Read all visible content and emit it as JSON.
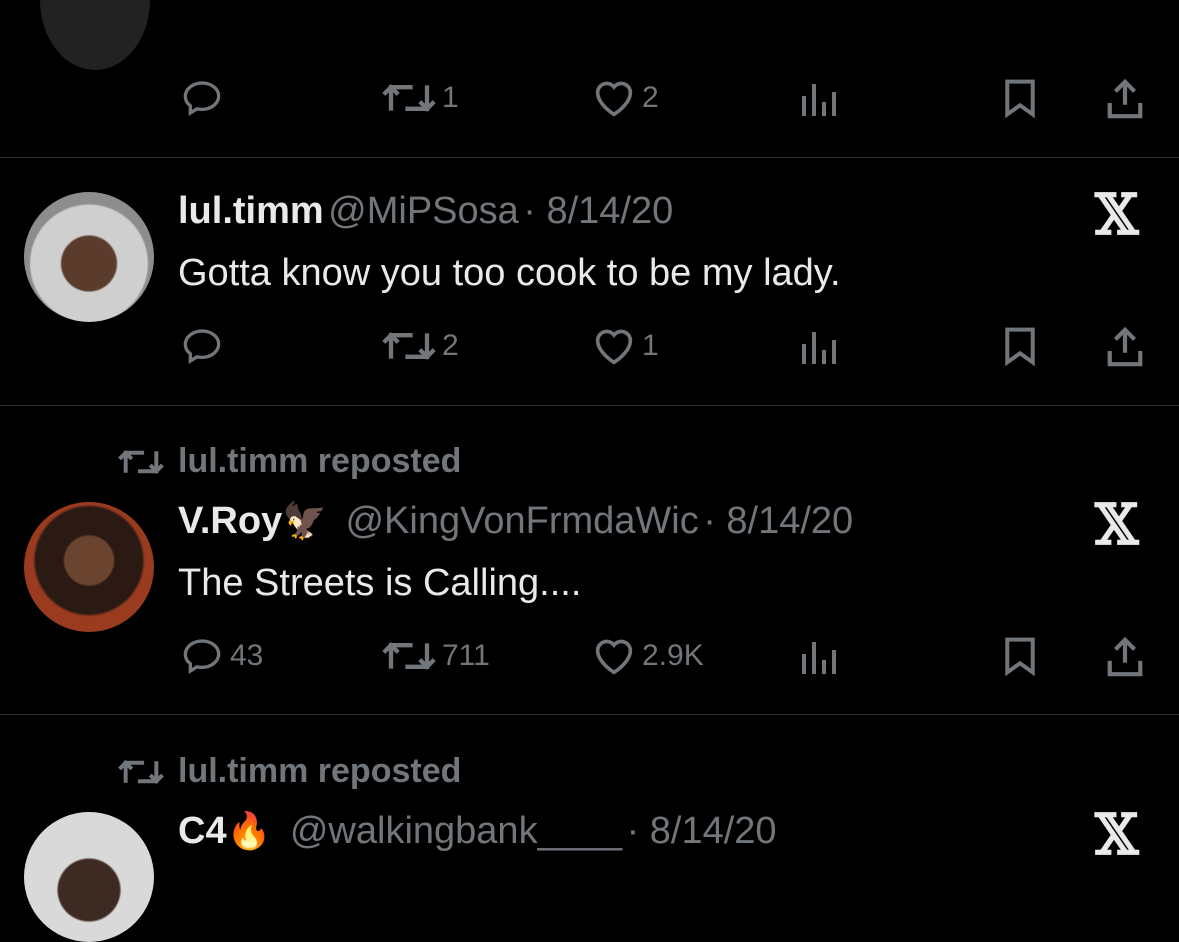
{
  "tweets": [
    {
      "reply": "",
      "retweets": "1",
      "likes": "2"
    },
    {
      "name": "lul.timm",
      "handle": "@MiPSosa",
      "date": "· 8/14/20",
      "text": "Gotta know you too cook to be my lady.",
      "reply": "",
      "retweets": "2",
      "likes": "1"
    },
    {
      "repost_label": "lul.timm reposted",
      "name": "V.Roy",
      "emoji": "🦅",
      "handle": "@KingVonFrmdaWic",
      "date": "· 8/14/20",
      "text": "The Streets is Calling....",
      "reply": "43",
      "retweets": "711",
      "likes": "2.9K"
    },
    {
      "repost_label": "lul.timm reposted",
      "name": "C4",
      "emoji": "🔥",
      "handle": "@walkingbank____",
      "date": "· 8/14/20"
    }
  ],
  "x_logo": "𝕏",
  "icons": [
    "reply-icon",
    "retweet-icon",
    "like-icon",
    "views-icon",
    "bookmark-icon",
    "share-icon",
    "x-logo-icon"
  ],
  "colors": {
    "background": "#000000",
    "text": "#e7e9ea",
    "muted": "#71767b",
    "divider": "#2f3336"
  }
}
